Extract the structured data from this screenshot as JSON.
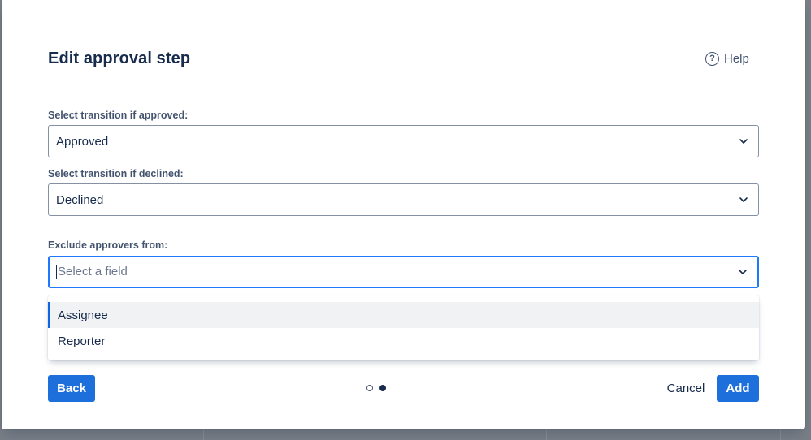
{
  "dialog": {
    "title": "Edit approval step",
    "help_label": "Help"
  },
  "fields": {
    "approved": {
      "label": "Select transition if approved:",
      "value": "Approved"
    },
    "declined": {
      "label": "Select transition if declined:",
      "value": "Declined"
    },
    "exclude": {
      "label": "Exclude approvers from:",
      "placeholder": "Select a field",
      "options": [
        "Assignee",
        "Reporter"
      ]
    }
  },
  "footer": {
    "back_label": "Back",
    "cancel_label": "Cancel",
    "add_label": "Add",
    "current_step": 2,
    "total_steps": 2
  },
  "icons": {
    "help": "help-circle-icon",
    "dropdown": "chevron-down-icon"
  },
  "colors": {
    "primary": "#1d6fdc",
    "focus_border": "#1d7afc",
    "text": "#172b4d"
  }
}
